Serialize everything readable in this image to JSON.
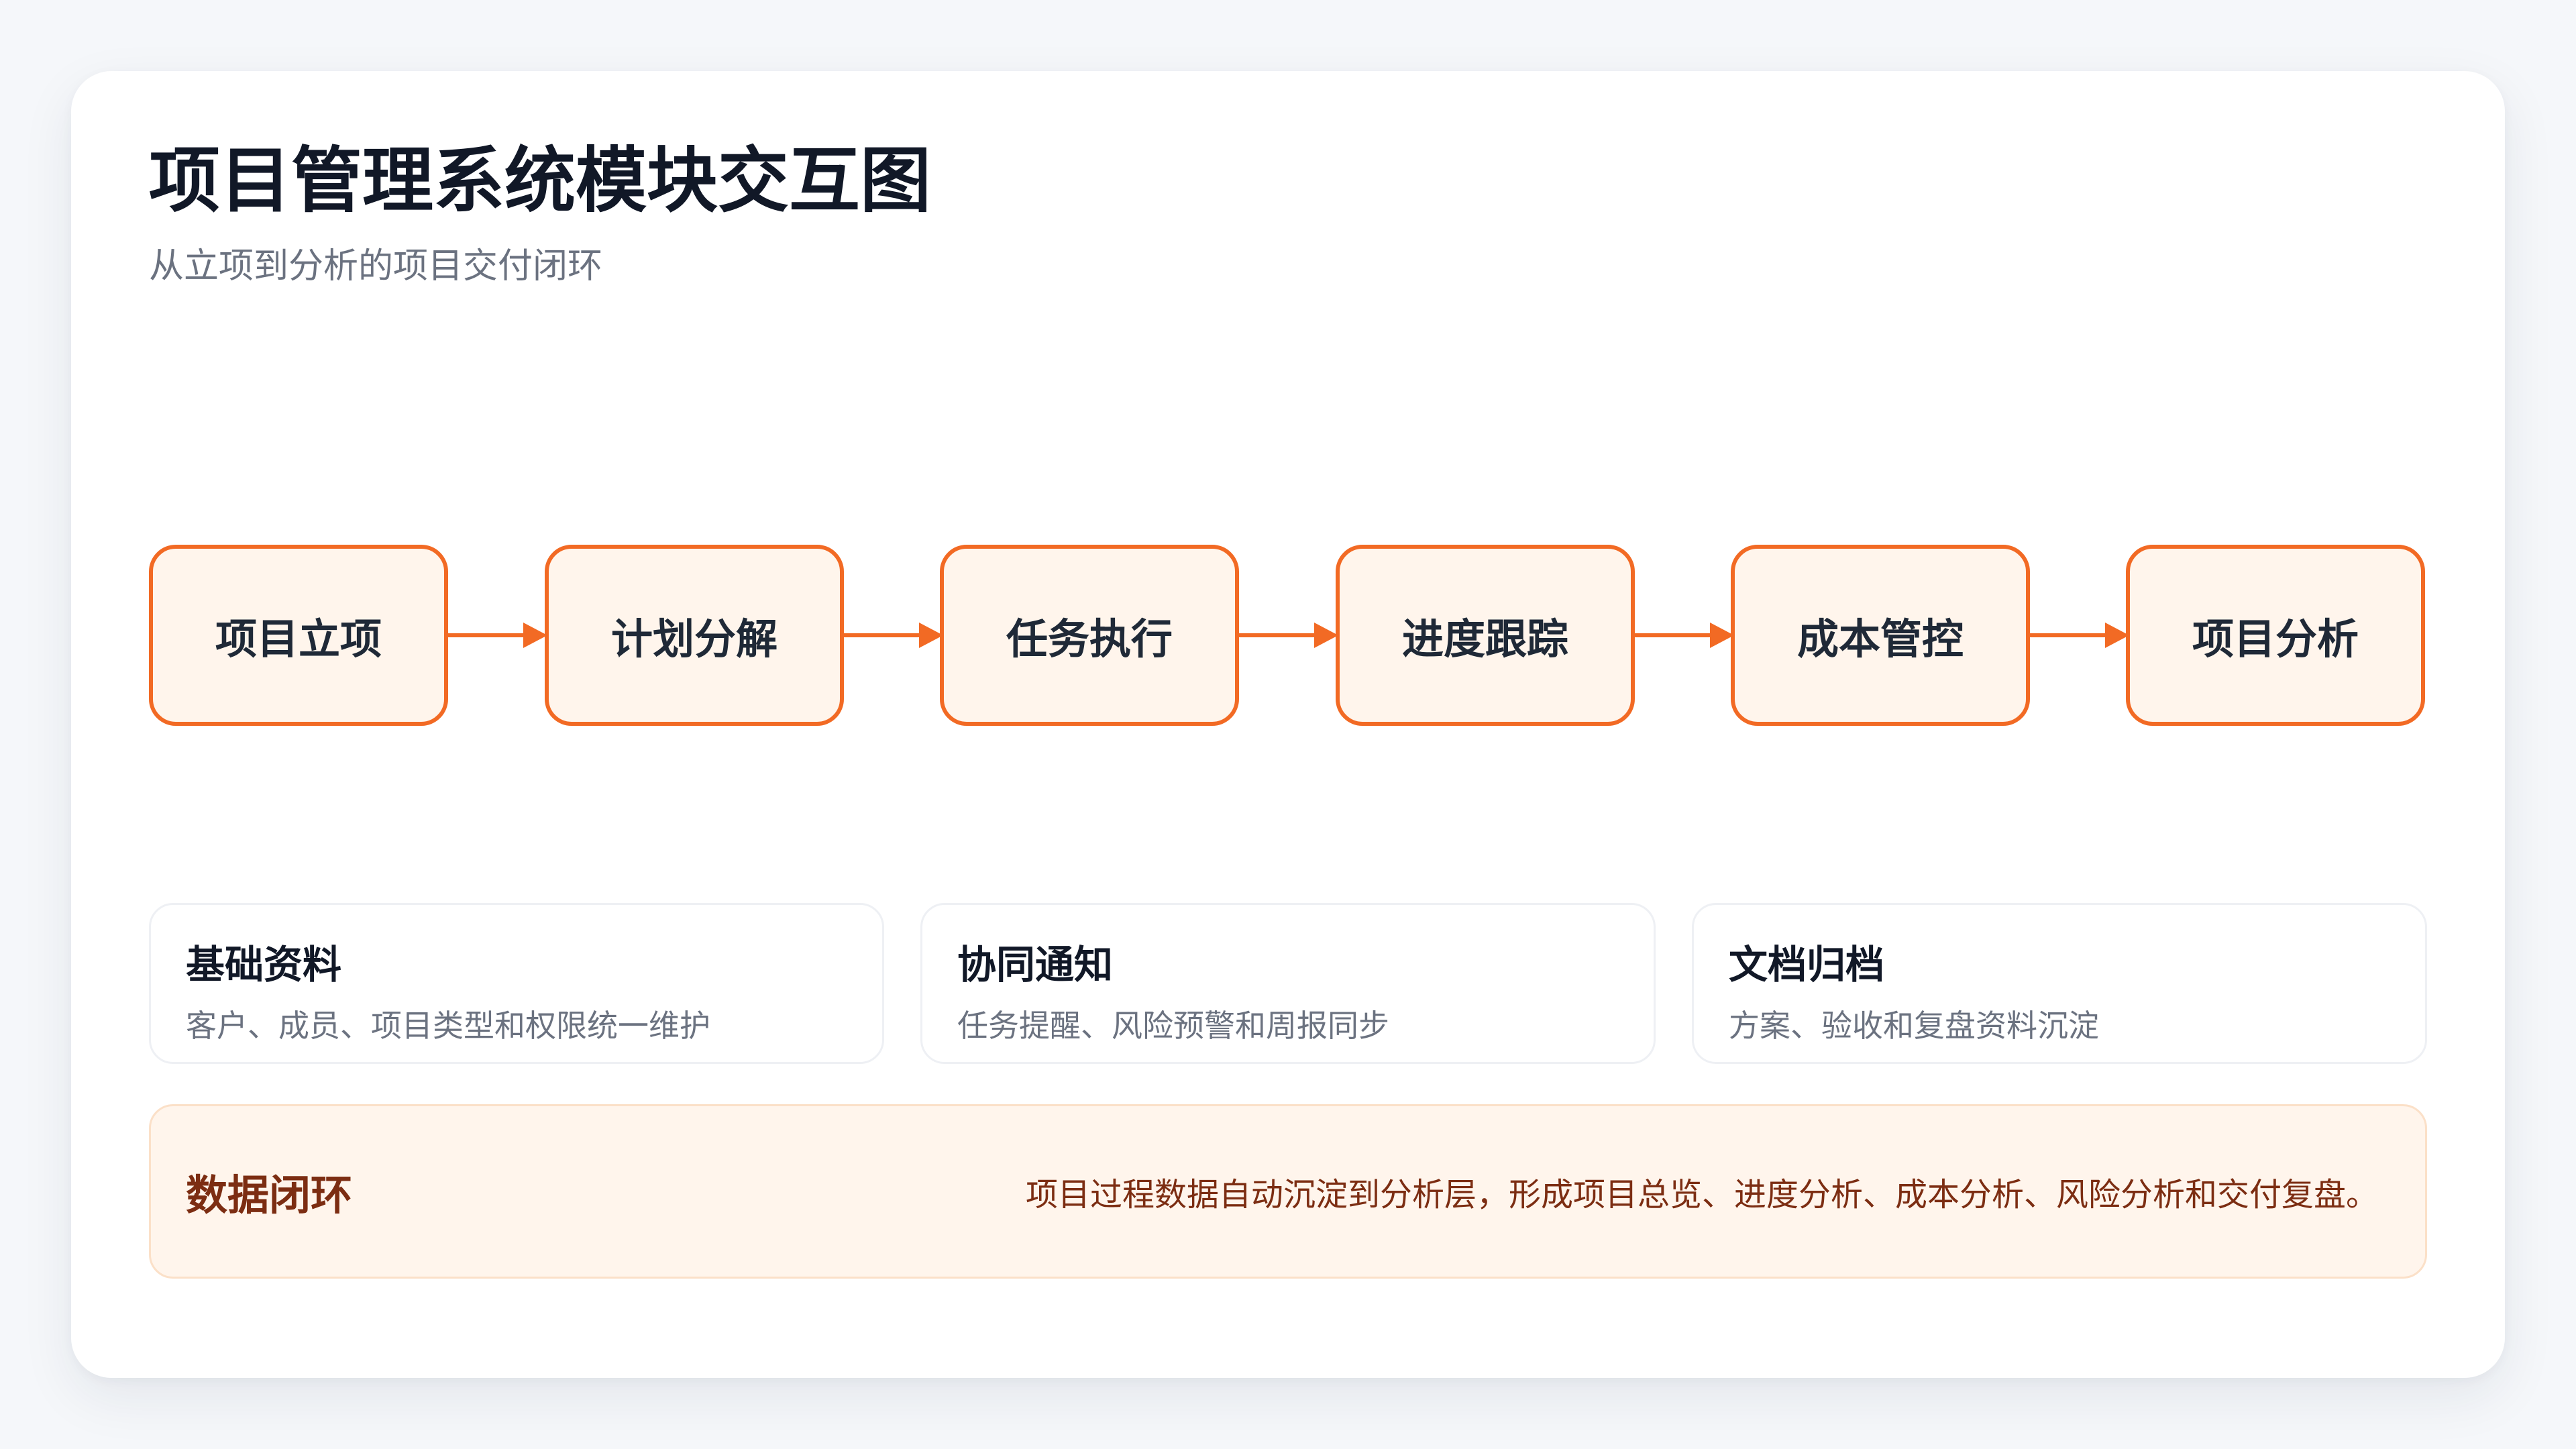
{
  "header": {
    "title": "项目管理系统模块交互图",
    "subtitle": "从立项到分析的项目交付闭环"
  },
  "flow": {
    "nodes": [
      "项目立项",
      "计划分解",
      "任务执行",
      "进度跟踪",
      "成本管控",
      "项目分析"
    ],
    "connector": "arrow-right"
  },
  "features": [
    {
      "title": "基础资料",
      "desc": "客户、成员、项目类型和权限统一维护"
    },
    {
      "title": "协同通知",
      "desc": "任务提醒、风险预警和周报同步"
    },
    {
      "title": "文档归档",
      "desc": "方案、验收和复盘资料沉淀"
    }
  ],
  "loop": {
    "title": "数据闭环",
    "desc": "项目过程数据自动沉淀到分析层，形成项目总览、进度分析、成本分析、风险分析和交付复盘。"
  },
  "colors": {
    "accent": "#f26a24",
    "node_fill": "#fff5ec",
    "background": "#f5f7fa",
    "card": "#ffffff",
    "title_text": "#111827",
    "muted_text": "#6b7280",
    "loop_text": "#7c2d12"
  }
}
